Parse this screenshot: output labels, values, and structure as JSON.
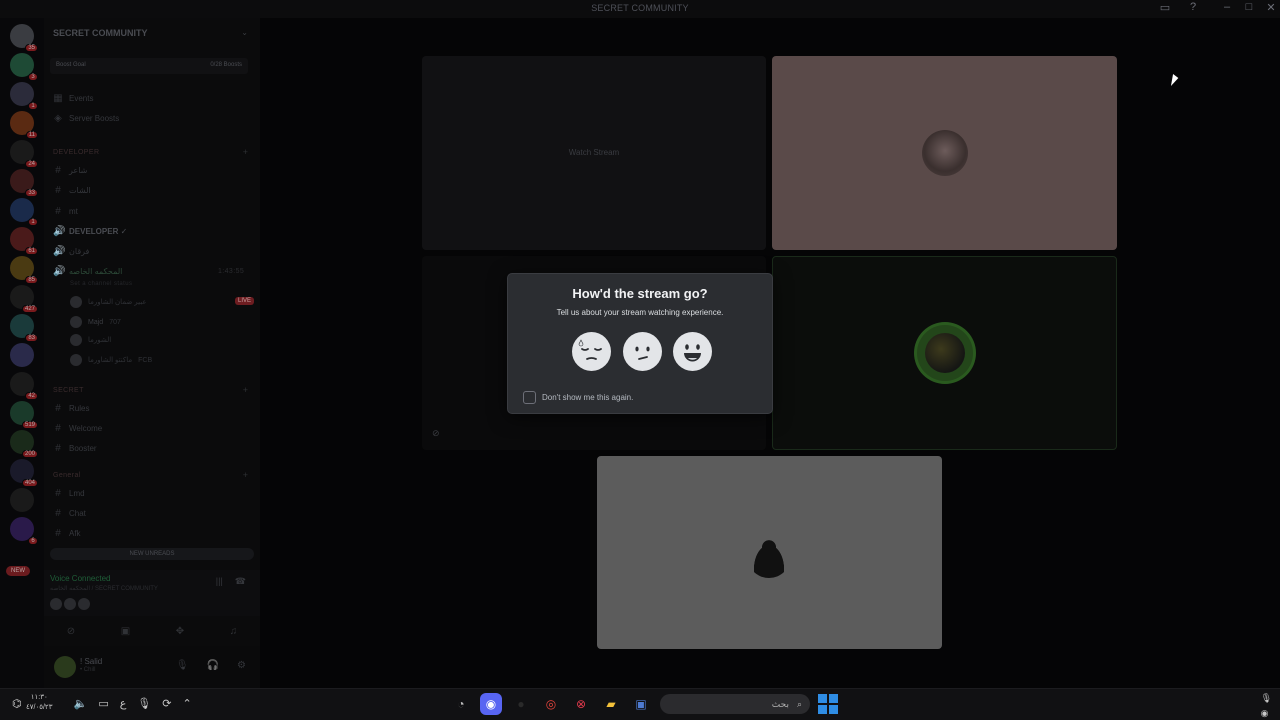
{
  "window": {
    "title": "SECRET COMMUNITY"
  },
  "server_rail": {
    "servers": [
      {
        "badge": "35",
        "color": "#3a3c41"
      },
      {
        "badge": "3",
        "color": "#1e4a35"
      },
      {
        "badge": "1",
        "color": "#2b2b3a"
      },
      {
        "badge": "11",
        "color": "#5a2a12"
      },
      {
        "badge": "24",
        "color": "#1a1a1a"
      },
      {
        "badge": "33",
        "color": "#3a1a1a"
      },
      {
        "badge": "1",
        "color": "#1a2a4a"
      },
      {
        "badge": "61",
        "color": "#4a1a1a"
      },
      {
        "badge": "85",
        "color": "#4a3a12"
      },
      {
        "badge": "427",
        "color": "#1a1a1a"
      },
      {
        "badge": "83",
        "color": "#1a3a3a"
      },
      {
        "badge": "",
        "color": "#2a2a4a"
      },
      {
        "badge": "42",
        "color": "#1a1a1a"
      },
      {
        "badge": "519",
        "color": "#1a3a2a"
      },
      {
        "badge": "200",
        "color": "#1a2a1a"
      },
      {
        "badge": "404",
        "color": "#1a1a2a"
      },
      {
        "badge": "",
        "color": "#1a1a1a"
      },
      {
        "badge": "6",
        "color": "#2a1a4a"
      }
    ],
    "new_pill": "NEW"
  },
  "sidebar": {
    "server_name": "SECRET COMMUNITY",
    "boost_goal": "Boost Goal",
    "boost_count": "0/28 Boosts",
    "items": [
      {
        "label": "Events",
        "icon": "calendar-icon"
      },
      {
        "label": "Server Boosts",
        "icon": "boost-icon"
      }
    ],
    "categories": {
      "developer": "DEVELOPER",
      "secret": "SECRET",
      "general": "General"
    },
    "dev_channels": [
      {
        "label": "شاعر",
        "icon": "hash"
      },
      {
        "label": "الشات",
        "icon": "hash"
      },
      {
        "label": "mt",
        "icon": "hash"
      },
      {
        "label": "DEVELOPER ✓",
        "icon": "speaker"
      },
      {
        "label": "فرقان",
        "icon": "speaker"
      },
      {
        "label": "المحكمه الخاصه",
        "icon": "speaker",
        "timer": "1:43:55"
      }
    ],
    "voice_sub": "Set a channel status",
    "voice_users": [
      {
        "name": "عبير ضمان الشاورما",
        "live": "LIVE"
      },
      {
        "name": "Majd",
        "tag": "707"
      },
      {
        "name": "الشورما"
      },
      {
        "name": "ماكنتو الشاورما",
        "tag": "FCB"
      }
    ],
    "secret_channels": [
      {
        "label": "Rules"
      },
      {
        "label": "Welcome"
      },
      {
        "label": "Booster"
      }
    ],
    "general_channels": [
      {
        "label": "Lmd"
      },
      {
        "label": "Chat"
      },
      {
        "label": "Afk"
      }
    ],
    "new_unreads": "NEW UNREADS",
    "voice_connected": "Voice Connected",
    "voice_location": "المحكمه الخاصه / SECRET COMMUNITY",
    "user": {
      "name": "! Salid",
      "status": "• Chill"
    }
  },
  "stage": {
    "watch_stream": "Watch Stream"
  },
  "modal": {
    "title": "How'd the stream go?",
    "subtitle": "Tell us about your stream watching experience.",
    "faces": [
      "sad-face-icon",
      "neutral-face-icon",
      "happy-face-icon"
    ],
    "dont_show": "Don't show me this again."
  },
  "taskbar": {
    "clock_time": "١١:٣٠",
    "clock_date": "٤٧/٠٥/٢٣",
    "lang": "ع",
    "search_placeholder": "بحث"
  }
}
